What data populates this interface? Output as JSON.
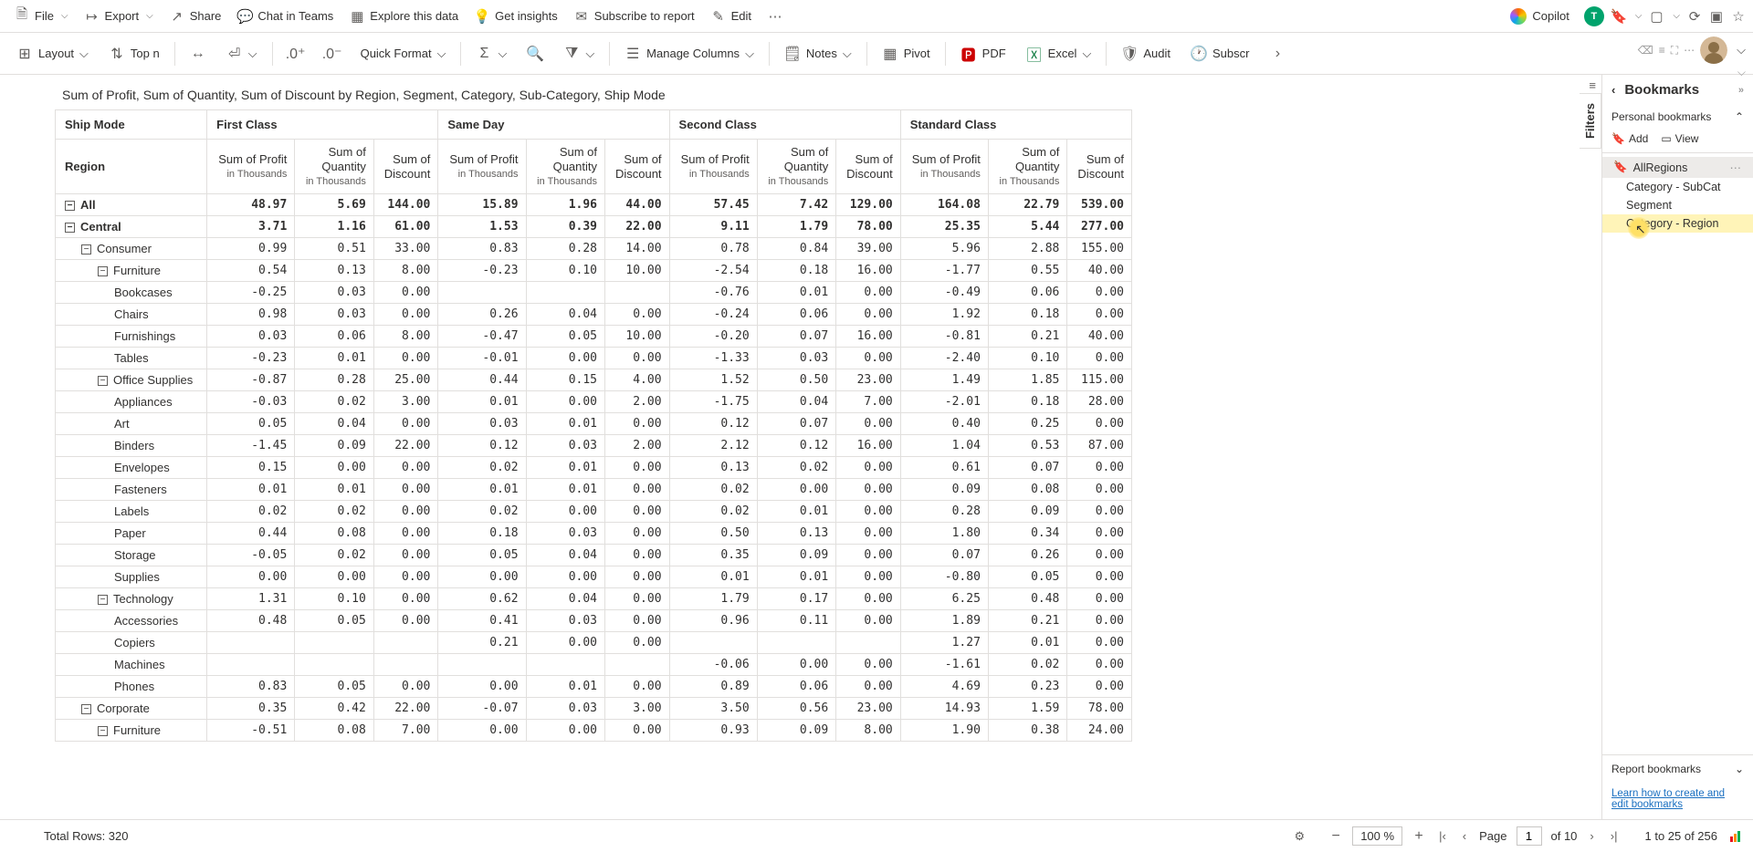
{
  "topbar": {
    "file": "File",
    "export": "Export",
    "share": "Share",
    "chat": "Chat in Teams",
    "explore": "Explore this data",
    "insights": "Get insights",
    "subscribe": "Subscribe to report",
    "edit": "Edit",
    "copilot": "Copilot"
  },
  "toolbar": {
    "layout": "Layout",
    "topn": "Top n",
    "quickfmt": "Quick Format",
    "managecols": "Manage Columns",
    "notes": "Notes",
    "pivot": "Pivot",
    "pdf": "PDF",
    "excel": "Excel",
    "audit": "Audit",
    "subscr": "Subscr"
  },
  "subtitle": "Sum of Profit, Sum of Quantity, Sum of Discount by Region, Segment, Category, Sub-Category, Ship Mode",
  "filters_label": "Filters",
  "headers": {
    "shipmode": "Ship Mode",
    "region": "Region",
    "groups": [
      "First Class",
      "Same Day",
      "Second Class",
      "Standard Class"
    ],
    "metrics": [
      {
        "l1": "Sum of Profit",
        "l2": "in Thousands"
      },
      {
        "l1": "Sum of",
        "l1b": "Quantity",
        "l2": "in Thousands"
      },
      {
        "l1": "Sum of",
        "l1b": "Discount",
        "l2": ""
      }
    ]
  },
  "rows": [
    {
      "label": "All",
      "lvl": 0,
      "exp": true,
      "bold": true,
      "v": [
        "48.97",
        "5.69",
        "144.00",
        "15.89",
        "1.96",
        "44.00",
        "57.45",
        "7.42",
        "129.00",
        "164.08",
        "22.79",
        "539.00"
      ]
    },
    {
      "label": "Central",
      "lvl": 0,
      "exp": true,
      "bold": true,
      "v": [
        "3.71",
        "1.16",
        "61.00",
        "1.53",
        "0.39",
        "22.00",
        "9.11",
        "1.79",
        "78.00",
        "25.35",
        "5.44",
        "277.00"
      ]
    },
    {
      "label": "Consumer",
      "lvl": 1,
      "exp": true,
      "v": [
        "0.99",
        "0.51",
        "33.00",
        "0.83",
        "0.28",
        "14.00",
        "0.78",
        "0.84",
        "39.00",
        "5.96",
        "2.88",
        "155.00"
      ]
    },
    {
      "label": "Furniture",
      "lvl": 2,
      "exp": true,
      "v": [
        "0.54",
        "0.13",
        "8.00",
        "-0.23",
        "0.10",
        "10.00",
        "-2.54",
        "0.18",
        "16.00",
        "-1.77",
        "0.55",
        "40.00"
      ]
    },
    {
      "label": "Bookcases",
      "lvl": 3,
      "v": [
        "-0.25",
        "0.03",
        "0.00",
        "",
        "",
        "",
        "-0.76",
        "0.01",
        "0.00",
        "-0.49",
        "0.06",
        "0.00"
      ]
    },
    {
      "label": "Chairs",
      "lvl": 3,
      "v": [
        "0.98",
        "0.03",
        "0.00",
        "0.26",
        "0.04",
        "0.00",
        "-0.24",
        "0.06",
        "0.00",
        "1.92",
        "0.18",
        "0.00"
      ]
    },
    {
      "label": "Furnishings",
      "lvl": 3,
      "v": [
        "0.03",
        "0.06",
        "8.00",
        "-0.47",
        "0.05",
        "10.00",
        "-0.20",
        "0.07",
        "16.00",
        "-0.81",
        "0.21",
        "40.00"
      ]
    },
    {
      "label": "Tables",
      "lvl": 3,
      "v": [
        "-0.23",
        "0.01",
        "0.00",
        "-0.01",
        "0.00",
        "0.00",
        "-1.33",
        "0.03",
        "0.00",
        "-2.40",
        "0.10",
        "0.00"
      ]
    },
    {
      "label": "Office Supplies",
      "lvl": 2,
      "exp": true,
      "v": [
        "-0.87",
        "0.28",
        "25.00",
        "0.44",
        "0.15",
        "4.00",
        "1.52",
        "0.50",
        "23.00",
        "1.49",
        "1.85",
        "115.00"
      ]
    },
    {
      "label": "Appliances",
      "lvl": 3,
      "v": [
        "-0.03",
        "0.02",
        "3.00",
        "0.01",
        "0.00",
        "2.00",
        "-1.75",
        "0.04",
        "7.00",
        "-2.01",
        "0.18",
        "28.00"
      ]
    },
    {
      "label": "Art",
      "lvl": 3,
      "v": [
        "0.05",
        "0.04",
        "0.00",
        "0.03",
        "0.01",
        "0.00",
        "0.12",
        "0.07",
        "0.00",
        "0.40",
        "0.25",
        "0.00"
      ]
    },
    {
      "label": "Binders",
      "lvl": 3,
      "v": [
        "-1.45",
        "0.09",
        "22.00",
        "0.12",
        "0.03",
        "2.00",
        "2.12",
        "0.12",
        "16.00",
        "1.04",
        "0.53",
        "87.00"
      ]
    },
    {
      "label": "Envelopes",
      "lvl": 3,
      "v": [
        "0.15",
        "0.00",
        "0.00",
        "0.02",
        "0.01",
        "0.00",
        "0.13",
        "0.02",
        "0.00",
        "0.61",
        "0.07",
        "0.00"
      ]
    },
    {
      "label": "Fasteners",
      "lvl": 3,
      "v": [
        "0.01",
        "0.01",
        "0.00",
        "0.01",
        "0.01",
        "0.00",
        "0.02",
        "0.00",
        "0.00",
        "0.09",
        "0.08",
        "0.00"
      ]
    },
    {
      "label": "Labels",
      "lvl": 3,
      "v": [
        "0.02",
        "0.02",
        "0.00",
        "0.02",
        "0.00",
        "0.00",
        "0.02",
        "0.01",
        "0.00",
        "0.28",
        "0.09",
        "0.00"
      ]
    },
    {
      "label": "Paper",
      "lvl": 3,
      "v": [
        "0.44",
        "0.08",
        "0.00",
        "0.18",
        "0.03",
        "0.00",
        "0.50",
        "0.13",
        "0.00",
        "1.80",
        "0.34",
        "0.00"
      ]
    },
    {
      "label": "Storage",
      "lvl": 3,
      "v": [
        "-0.05",
        "0.02",
        "0.00",
        "0.05",
        "0.04",
        "0.00",
        "0.35",
        "0.09",
        "0.00",
        "0.07",
        "0.26",
        "0.00"
      ]
    },
    {
      "label": "Supplies",
      "lvl": 3,
      "v": [
        "0.00",
        "0.00",
        "0.00",
        "0.00",
        "0.00",
        "0.00",
        "0.01",
        "0.01",
        "0.00",
        "-0.80",
        "0.05",
        "0.00"
      ]
    },
    {
      "label": "Technology",
      "lvl": 2,
      "exp": true,
      "v": [
        "1.31",
        "0.10",
        "0.00",
        "0.62",
        "0.04",
        "0.00",
        "1.79",
        "0.17",
        "0.00",
        "6.25",
        "0.48",
        "0.00"
      ]
    },
    {
      "label": "Accessories",
      "lvl": 3,
      "v": [
        "0.48",
        "0.05",
        "0.00",
        "0.41",
        "0.03",
        "0.00",
        "0.96",
        "0.11",
        "0.00",
        "1.89",
        "0.21",
        "0.00"
      ]
    },
    {
      "label": "Copiers",
      "lvl": 3,
      "v": [
        "",
        "",
        "",
        "0.21",
        "0.00",
        "0.00",
        "",
        "",
        "",
        "1.27",
        "0.01",
        "0.00"
      ]
    },
    {
      "label": "Machines",
      "lvl": 3,
      "v": [
        "",
        "",
        "",
        "",
        "",
        "",
        "-0.06",
        "0.00",
        "0.00",
        "-1.61",
        "0.02",
        "0.00"
      ]
    },
    {
      "label": "Phones",
      "lvl": 3,
      "v": [
        "0.83",
        "0.05",
        "0.00",
        "0.00",
        "0.01",
        "0.00",
        "0.89",
        "0.06",
        "0.00",
        "4.69",
        "0.23",
        "0.00"
      ]
    },
    {
      "label": "Corporate",
      "lvl": 1,
      "exp": true,
      "v": [
        "0.35",
        "0.42",
        "22.00",
        "-0.07",
        "0.03",
        "3.00",
        "3.50",
        "0.56",
        "23.00",
        "14.93",
        "1.59",
        "78.00"
      ]
    },
    {
      "label": "Furniture",
      "lvl": 2,
      "exp": true,
      "v": [
        "-0.51",
        "0.08",
        "7.00",
        "0.00",
        "0.00",
        "0.00",
        "0.93",
        "0.09",
        "8.00",
        "1.90",
        "0.38",
        "24.00"
      ]
    }
  ],
  "sidebar": {
    "title": "Bookmarks",
    "personal": "Personal bookmarks",
    "add": "Add",
    "view": "View",
    "items": [
      {
        "label": "AllRegions",
        "sel": true
      },
      {
        "label": "Category - SubCat"
      },
      {
        "label": "Segment"
      },
      {
        "label": "Category - Region",
        "hl": true
      }
    ],
    "report": "Report bookmarks",
    "learn": "Learn how to create and edit bookmarks"
  },
  "status": {
    "total": "Total Rows: 320",
    "zoom": "100 %",
    "page_lbl": "Page",
    "page_cur": "1",
    "page_of": "of 10",
    "range": "1 to 25 of 256"
  }
}
